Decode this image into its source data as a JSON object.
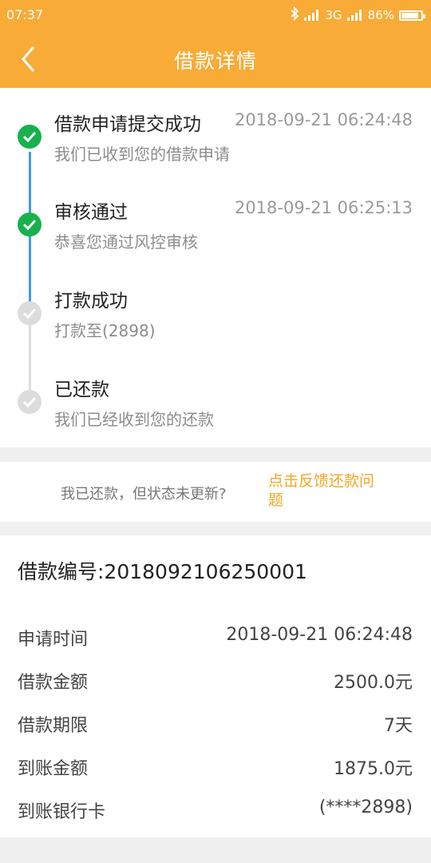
{
  "status_bar": {
    "time": "07:37",
    "network_1": "3G",
    "network_2": "3G",
    "battery": "86%",
    "battery_level": 0.86
  },
  "header": {
    "title": "借款详情",
    "back_icon": "chevron-left-icon"
  },
  "colors": {
    "accent": "#f8ab37",
    "success": "#19b14d",
    "link": "#f5a623",
    "progress_line": "#3f9de4",
    "pending": "#dcdcdc"
  },
  "timeline": [
    {
      "title": "借款申请提交成功",
      "time": "2018-09-21 06:24:48",
      "desc": "我们已收到您的借款申请",
      "state": "done"
    },
    {
      "title": "审核通过",
      "time": "2018-09-21 06:25:13",
      "desc": "恭喜您通过风控审核",
      "state": "done"
    },
    {
      "title": "打款成功",
      "time": "",
      "desc": "打款至(2898)",
      "state": "pending"
    },
    {
      "title": "已还款",
      "time": "",
      "desc": "我们已经收到您的还款",
      "state": "pending"
    }
  ],
  "feedback": {
    "question": "我已还款，但状态未更新?",
    "link": "点击反馈还款问题"
  },
  "details": {
    "loan_number": "借款编号:2018092106250001",
    "rows": [
      {
        "label": "申请时间",
        "value": "2018-09-21 06:24:48"
      },
      {
        "label": "借款金额",
        "value": "2500.0元"
      },
      {
        "label": "借款期限",
        "value": "7天"
      },
      {
        "label": "到账金额",
        "value": "1875.0元"
      },
      {
        "label": "到账银行卡",
        "value": "(****2898)"
      }
    ]
  }
}
